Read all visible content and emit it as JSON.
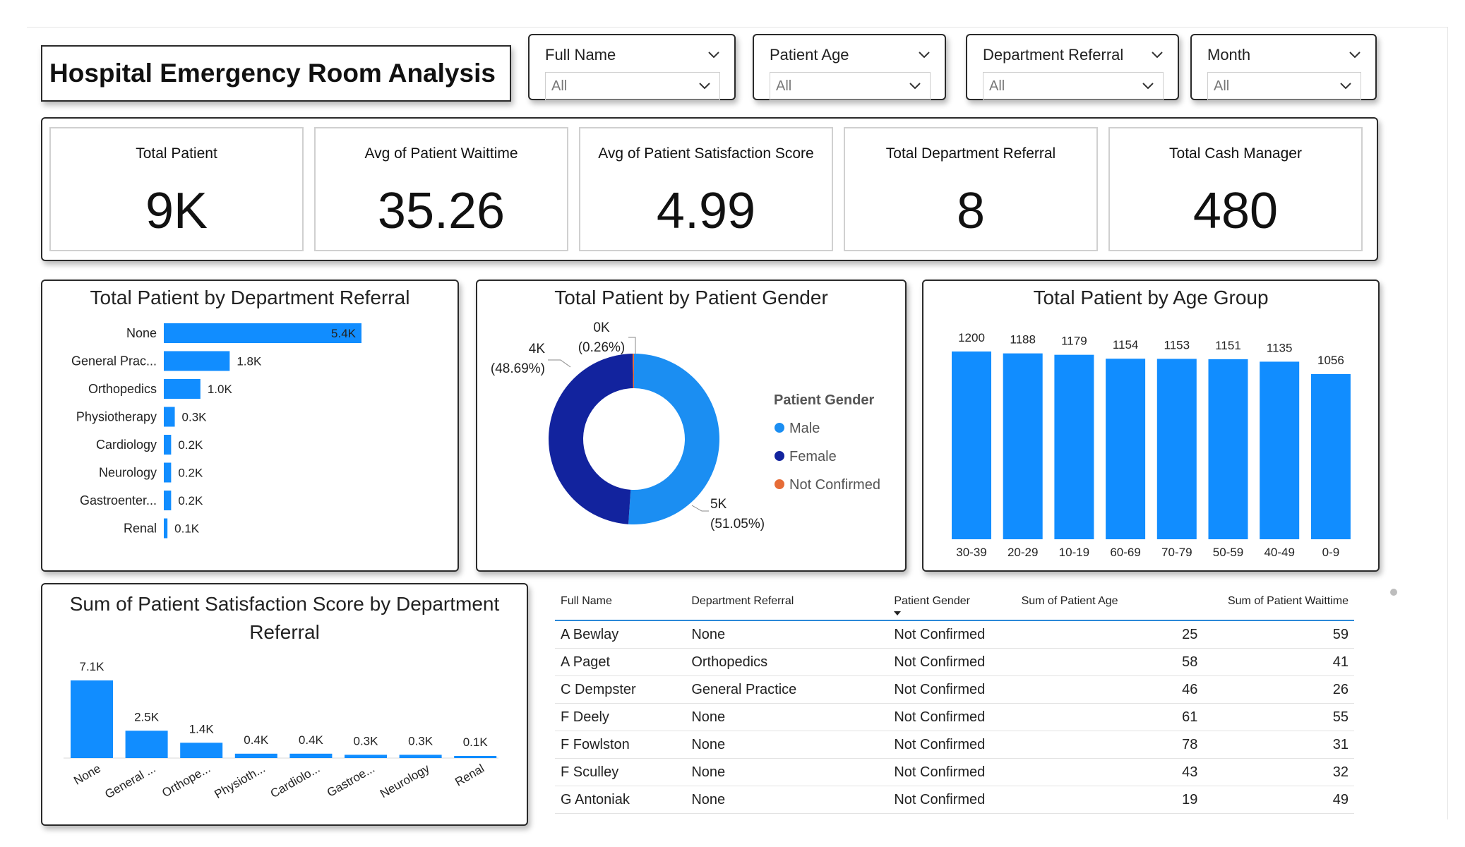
{
  "title": "Hospital Emergency Room Analysis",
  "colors": {
    "bar": "#118DFF",
    "male": "#1b8ef2",
    "female": "#12239e",
    "not_confirmed": "#e66c37"
  },
  "slicers": [
    {
      "label": "Full Name",
      "value": "All"
    },
    {
      "label": "Patient Age",
      "value": "All"
    },
    {
      "label": "Department Referral",
      "value": "All"
    },
    {
      "label": "Month",
      "value": "All"
    }
  ],
  "kpis": [
    {
      "label": "Total Patient",
      "value": "9K"
    },
    {
      "label": "Avg of Patient Waittime",
      "value": "35.26"
    },
    {
      "label": "Avg of Patient Satisfaction Score",
      "value": "4.99"
    },
    {
      "label": "Total Department Referral",
      "value": "8"
    },
    {
      "label": "Total Cash Manager",
      "value": "480"
    }
  ],
  "chart_data": [
    {
      "type": "bar",
      "orientation": "horizontal",
      "title": "Total Patient by Department Referral",
      "categories": [
        "None",
        "General Prac...",
        "Orthopedics",
        "Physiotherapy",
        "Cardiology",
        "Neurology",
        "Gastroenter...",
        "Renal"
      ],
      "values": [
        5400,
        1800,
        1000,
        300,
        200,
        200,
        200,
        100
      ],
      "labels": [
        "5.4K",
        "1.8K",
        "1.0K",
        "0.3K",
        "0.2K",
        "0.2K",
        "0.2K",
        "0.1K"
      ],
      "xlim": [
        0,
        5400
      ]
    },
    {
      "type": "pie",
      "donut": true,
      "title": "Total Patient by Patient Gender",
      "legend_title": "Patient Gender",
      "legend_position": "right",
      "slices": [
        {
          "name": "Male",
          "value_label": "5K",
          "pct_label": "(51.05%)",
          "pct": 51.05
        },
        {
          "name": "Female",
          "value_label": "4K",
          "pct_label": "(48.69%)",
          "pct": 48.69
        },
        {
          "name": "Not Confirmed",
          "value_label": "0K",
          "pct_label": "(0.26%)",
          "pct": 0.26
        }
      ]
    },
    {
      "type": "bar",
      "title": "Total Patient by Age Group",
      "categories": [
        "30-39",
        "20-29",
        "10-19",
        "60-69",
        "70-79",
        "50-59",
        "40-49",
        "0-9"
      ],
      "values": [
        1200,
        1188,
        1179,
        1154,
        1153,
        1151,
        1135,
        1056
      ],
      "ylim": [
        0,
        1200
      ]
    },
    {
      "type": "bar",
      "title": "Sum of Patient Satisfaction Score by Department Referral",
      "categories": [
        "None",
        "General ...",
        "Orthope...",
        "Physioth...",
        "Cardiolo...",
        "Gastroe...",
        "Neurology",
        "Renal"
      ],
      "values": [
        7100,
        2500,
        1400,
        400,
        400,
        300,
        300,
        100
      ],
      "labels": [
        "7.1K",
        "2.5K",
        "1.4K",
        "0.4K",
        "0.4K",
        "0.3K",
        "0.3K",
        "0.1K"
      ],
      "ylim": [
        0,
        7100
      ]
    }
  ],
  "table": {
    "columns": [
      "Full Name",
      "Department Referral",
      "Patient Gender",
      "Sum of Patient Age",
      "Sum of Patient Waittime"
    ],
    "rows": [
      [
        "A Bewlay",
        "None",
        "Not Confirmed",
        "25",
        "59"
      ],
      [
        "A Paget",
        "Orthopedics",
        "Not Confirmed",
        "58",
        "41"
      ],
      [
        "C Dempster",
        "General Practice",
        "Not Confirmed",
        "46",
        "26"
      ],
      [
        "F Deely",
        "None",
        "Not Confirmed",
        "61",
        "55"
      ],
      [
        "F Fowlston",
        "None",
        "Not Confirmed",
        "78",
        "31"
      ],
      [
        "F Sculley",
        "None",
        "Not Confirmed",
        "43",
        "32"
      ],
      [
        "G Antoniak",
        "None",
        "Not Confirmed",
        "19",
        "49"
      ]
    ]
  }
}
